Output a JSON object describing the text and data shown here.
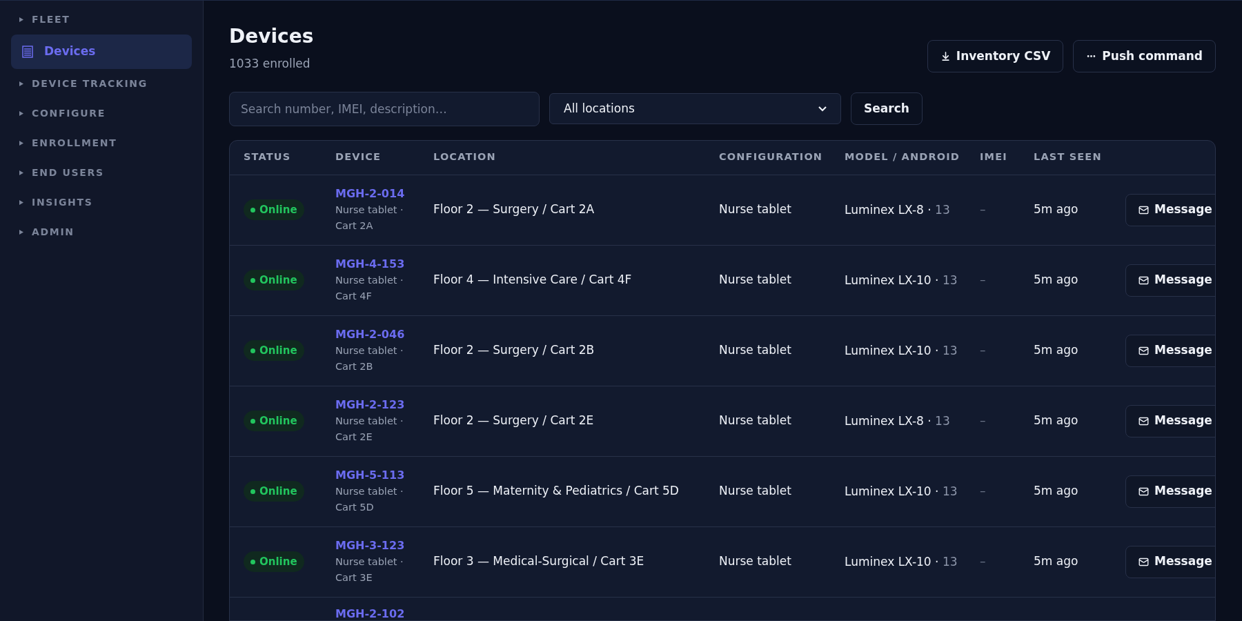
{
  "sidebar": {
    "items": [
      {
        "kind": "section",
        "label": "FLEET",
        "selected": false
      },
      {
        "kind": "link",
        "label": "Devices",
        "selected": true
      },
      {
        "kind": "section",
        "label": "DEVICE TRACKING",
        "selected": false
      },
      {
        "kind": "section",
        "label": "CONFIGURE",
        "selected": false
      },
      {
        "kind": "section",
        "label": "ENROLLMENT",
        "selected": false
      },
      {
        "kind": "section",
        "label": "END USERS",
        "selected": false
      },
      {
        "kind": "section",
        "label": "INSIGHTS",
        "selected": false
      },
      {
        "kind": "section",
        "label": "ADMIN",
        "selected": false
      }
    ]
  },
  "header": {
    "title": "Devices",
    "subtitle": "1033 enrolled",
    "buttons": [
      {
        "kind": "download",
        "label": "Inventory CSV"
      },
      {
        "kind": "more",
        "label": "Push command"
      }
    ]
  },
  "filters": {
    "search": {
      "placeholder": "Search number, IMEI, description…"
    },
    "location": {
      "value": "All locations"
    },
    "button": "Search"
  },
  "table": {
    "columns": [
      "STATUS",
      "DEVICE",
      "LOCATION",
      "CONFIGURATION",
      "MODEL / ANDROID",
      "IMEI",
      "LAST SEEN"
    ],
    "rows": [
      {
        "status": {
          "label": "Online",
          "color": "#22c55e"
        },
        "device": "MGH-2-014",
        "description": "Nurse tablet · Cart 2A",
        "location": "Floor 2 — Surgery / Cart 2A",
        "configuration": "Nurse tablet",
        "model": "Luminex LX-8 ·",
        "android": "13",
        "imei": "–",
        "last_seen": "5m ago",
        "action": "Message"
      },
      {
        "status": {
          "label": "Online",
          "color": "#22c55e"
        },
        "device": "MGH-4-153",
        "description": "Nurse tablet · Cart 4F",
        "location": "Floor 4 — Intensive Care / Cart 4F",
        "configuration": "Nurse tablet",
        "model": "Luminex LX-10 ·",
        "android": "13",
        "imei": "–",
        "last_seen": "5m ago",
        "action": "Message"
      },
      {
        "status": {
          "label": "Online",
          "color": "#22c55e"
        },
        "device": "MGH-2-046",
        "description": "Nurse tablet · Cart 2B",
        "location": "Floor 2 — Surgery / Cart 2B",
        "configuration": "Nurse tablet",
        "model": "Luminex LX-10 ·",
        "android": "13",
        "imei": "–",
        "last_seen": "5m ago",
        "action": "Message"
      },
      {
        "status": {
          "label": "Online",
          "color": "#22c55e"
        },
        "device": "MGH-2-123",
        "description": "Nurse tablet · Cart 2E",
        "location": "Floor 2 — Surgery / Cart 2E",
        "configuration": "Nurse tablet",
        "model": "Luminex LX-8 ·",
        "android": "13",
        "imei": "–",
        "last_seen": "5m ago",
        "action": "Message"
      },
      {
        "status": {
          "label": "Online",
          "color": "#22c55e"
        },
        "device": "MGH-5-113",
        "description": "Nurse tablet · Cart 5D",
        "location": "Floor 5 — Maternity & Pediatrics / Cart 5D",
        "configuration": "Nurse tablet",
        "model": "Luminex LX-10 ·",
        "android": "13",
        "imei": "–",
        "last_seen": "5m ago",
        "action": "Message"
      },
      {
        "status": {
          "label": "Online",
          "color": "#22c55e"
        },
        "device": "MGH-3-123",
        "description": "Nurse tablet · Cart 3E",
        "location": "Floor 3 — Medical-Surgical / Cart 3E",
        "configuration": "Nurse tablet",
        "model": "Luminex LX-10 ·",
        "android": "13",
        "imei": "–",
        "last_seen": "5m ago",
        "action": "Message"
      },
      {
        "device": "MGH-2-102"
      }
    ]
  }
}
